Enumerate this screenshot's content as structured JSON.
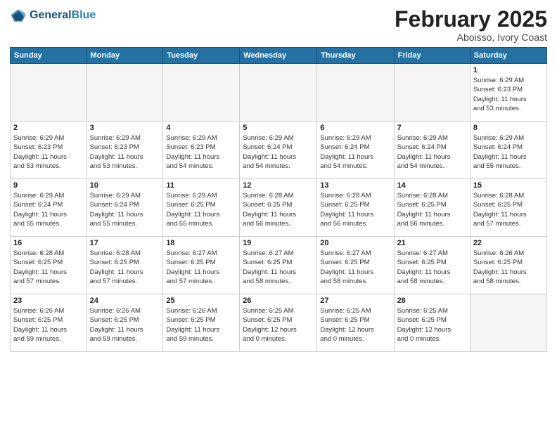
{
  "header": {
    "logo_line1": "General",
    "logo_line2": "Blue",
    "month": "February 2025",
    "location": "Aboisso, Ivory Coast"
  },
  "days_of_week": [
    "Sunday",
    "Monday",
    "Tuesday",
    "Wednesday",
    "Thursday",
    "Friday",
    "Saturday"
  ],
  "weeks": [
    [
      {
        "day": "",
        "info": ""
      },
      {
        "day": "",
        "info": ""
      },
      {
        "day": "",
        "info": ""
      },
      {
        "day": "",
        "info": ""
      },
      {
        "day": "",
        "info": ""
      },
      {
        "day": "",
        "info": ""
      },
      {
        "day": "1",
        "info": "Sunrise: 6:29 AM\nSunset: 6:23 PM\nDaylight: 11 hours\nand 53 minutes."
      }
    ],
    [
      {
        "day": "2",
        "info": "Sunrise: 6:29 AM\nSunset: 6:23 PM\nDaylight: 11 hours\nand 53 minutes."
      },
      {
        "day": "3",
        "info": "Sunrise: 6:29 AM\nSunset: 6:23 PM\nDaylight: 11 hours\nand 53 minutes."
      },
      {
        "day": "4",
        "info": "Sunrise: 6:29 AM\nSunset: 6:23 PM\nDaylight: 11 hours\nand 54 minutes."
      },
      {
        "day": "5",
        "info": "Sunrise: 6:29 AM\nSunset: 6:24 PM\nDaylight: 11 hours\nand 54 minutes."
      },
      {
        "day": "6",
        "info": "Sunrise: 6:29 AM\nSunset: 6:24 PM\nDaylight: 11 hours\nand 54 minutes."
      },
      {
        "day": "7",
        "info": "Sunrise: 6:29 AM\nSunset: 6:24 PM\nDaylight: 11 hours\nand 54 minutes."
      },
      {
        "day": "8",
        "info": "Sunrise: 6:29 AM\nSunset: 6:24 PM\nDaylight: 11 hours\nand 55 minutes."
      }
    ],
    [
      {
        "day": "9",
        "info": "Sunrise: 6:29 AM\nSunset: 6:24 PM\nDaylight: 11 hours\nand 55 minutes."
      },
      {
        "day": "10",
        "info": "Sunrise: 6:29 AM\nSunset: 6:24 PM\nDaylight: 11 hours\nand 55 minutes."
      },
      {
        "day": "11",
        "info": "Sunrise: 6:29 AM\nSunset: 6:25 PM\nDaylight: 11 hours\nand 55 minutes."
      },
      {
        "day": "12",
        "info": "Sunrise: 6:28 AM\nSunset: 6:25 PM\nDaylight: 11 hours\nand 56 minutes."
      },
      {
        "day": "13",
        "info": "Sunrise: 6:28 AM\nSunset: 6:25 PM\nDaylight: 11 hours\nand 56 minutes."
      },
      {
        "day": "14",
        "info": "Sunrise: 6:28 AM\nSunset: 6:25 PM\nDaylight: 11 hours\nand 56 minutes."
      },
      {
        "day": "15",
        "info": "Sunrise: 6:28 AM\nSunset: 6:25 PM\nDaylight: 11 hours\nand 57 minutes."
      }
    ],
    [
      {
        "day": "16",
        "info": "Sunrise: 6:28 AM\nSunset: 6:25 PM\nDaylight: 11 hours\nand 57 minutes."
      },
      {
        "day": "17",
        "info": "Sunrise: 6:28 AM\nSunset: 6:25 PM\nDaylight: 11 hours\nand 57 minutes."
      },
      {
        "day": "18",
        "info": "Sunrise: 6:27 AM\nSunset: 6:25 PM\nDaylight: 11 hours\nand 57 minutes."
      },
      {
        "day": "19",
        "info": "Sunrise: 6:27 AM\nSunset: 6:25 PM\nDaylight: 11 hours\nand 58 minutes."
      },
      {
        "day": "20",
        "info": "Sunrise: 6:27 AM\nSunset: 6:25 PM\nDaylight: 11 hours\nand 58 minutes."
      },
      {
        "day": "21",
        "info": "Sunrise: 6:27 AM\nSunset: 6:25 PM\nDaylight: 11 hours\nand 58 minutes."
      },
      {
        "day": "22",
        "info": "Sunrise: 6:26 AM\nSunset: 6:25 PM\nDaylight: 11 hours\nand 58 minutes."
      }
    ],
    [
      {
        "day": "23",
        "info": "Sunrise: 6:26 AM\nSunset: 6:25 PM\nDaylight: 11 hours\nand 59 minutes."
      },
      {
        "day": "24",
        "info": "Sunrise: 6:26 AM\nSunset: 6:25 PM\nDaylight: 11 hours\nand 59 minutes."
      },
      {
        "day": "25",
        "info": "Sunrise: 6:26 AM\nSunset: 6:25 PM\nDaylight: 11 hours\nand 59 minutes."
      },
      {
        "day": "26",
        "info": "Sunrise: 6:25 AM\nSunset: 6:25 PM\nDaylight: 12 hours\nand 0 minutes."
      },
      {
        "day": "27",
        "info": "Sunrise: 6:25 AM\nSunset: 6:25 PM\nDaylight: 12 hours\nand 0 minutes."
      },
      {
        "day": "28",
        "info": "Sunrise: 6:25 AM\nSunset: 6:25 PM\nDaylight: 12 hours\nand 0 minutes."
      },
      {
        "day": "",
        "info": ""
      }
    ]
  ]
}
